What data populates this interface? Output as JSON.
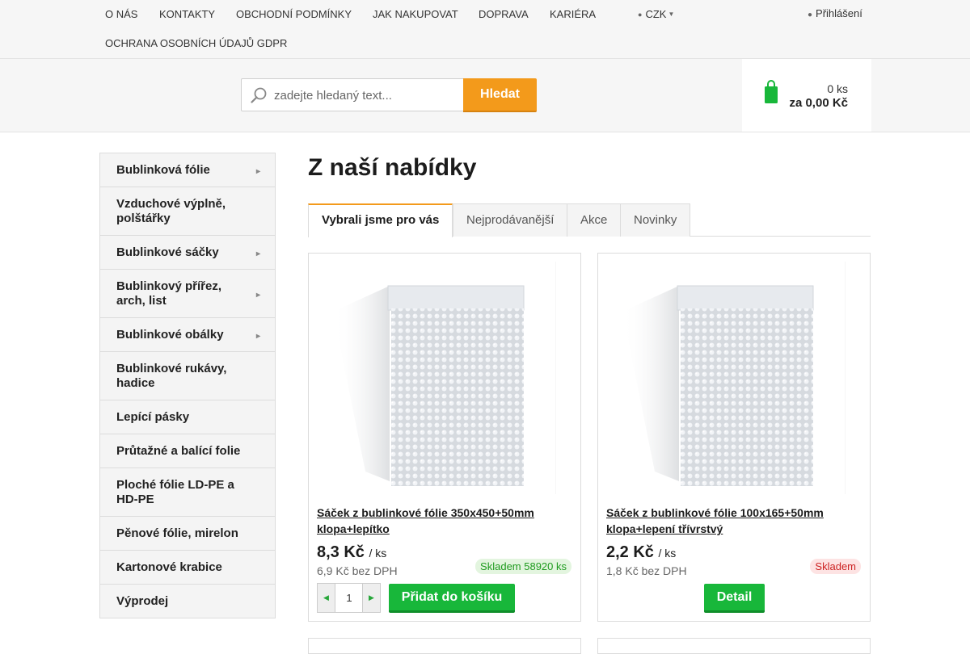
{
  "topnav": {
    "links": [
      "O NÁS",
      "KONTAKTY",
      "OBCHODNÍ PODMÍNKY",
      "JAK NAKUPOVAT",
      "DOPRAVA",
      "KARIÉRA",
      "OCHRANA OSOBNÍCH ÚDAJŮ GDPR"
    ],
    "currency": "CZK",
    "currency_icon": "globe-icon",
    "login": "Přihlášení",
    "login_icon": "user-icon"
  },
  "search": {
    "placeholder": "zadejte hledaný text...",
    "button": "Hledat"
  },
  "cart": {
    "count": "0 ks",
    "total": "za 0,00 Kč",
    "icon": "shopping-bag-icon"
  },
  "sidebar": {
    "items": [
      {
        "label": "Bublinková fólie",
        "expand": true
      },
      {
        "label": "Vzduchové výplně, polštářky",
        "expand": false
      },
      {
        "label": "Bublinkové sáčky",
        "expand": true
      },
      {
        "label": "Bublinkový přířez, arch, list",
        "expand": true
      },
      {
        "label": "Bublinkové obálky",
        "expand": true
      },
      {
        "label": "Bublinkové rukávy, hadice",
        "expand": false
      },
      {
        "label": "Lepící pásky",
        "expand": false
      },
      {
        "label": "Průtažné a balící folie",
        "expand": false
      },
      {
        "label": "Ploché fólie LD-PE a HD-PE",
        "expand": false
      },
      {
        "label": "Pěnové fólie, mirelon",
        "expand": false
      },
      {
        "label": "Kartonové krabice",
        "expand": false
      },
      {
        "label": "Výprodej",
        "expand": false
      }
    ]
  },
  "main": {
    "title": "Z naší nabídky",
    "tabs": [
      "Vybrali jsme pro vás",
      "Nejprodávanější",
      "Akce",
      "Novinky"
    ],
    "active_tab": 0
  },
  "products": [
    {
      "name": "Sáček z bublinkové fólie 350x450+50mm klopa+lepítko",
      "price": "8,3 Kč",
      "unit": "/ ks",
      "net": "6,9 Kč bez DPH",
      "stock": "Skladem 58920 ks",
      "stock_color": "green",
      "qty": "1",
      "button": "Přidat do košíku"
    },
    {
      "name": "Sáček z bublinkové fólie 100x165+50mm klopa+lepení třívrstvý",
      "price": "2,2 Kč",
      "unit": "/ ks",
      "net": "1,8 Kč bez DPH",
      "stock": "Skladem",
      "stock_color": "red",
      "button": "Detail"
    }
  ],
  "colors": {
    "accent": "#f39a1b",
    "green": "#18b73a",
    "text": "#222222"
  }
}
